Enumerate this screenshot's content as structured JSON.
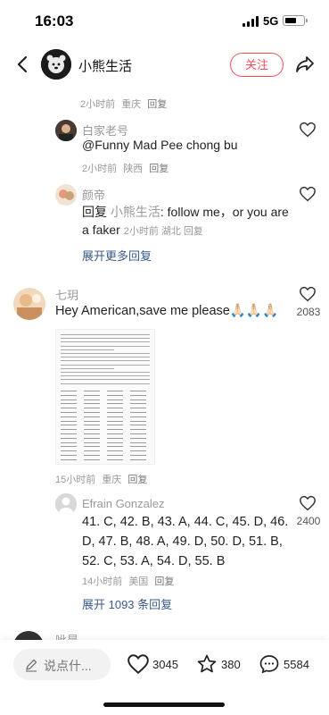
{
  "status": {
    "time": "16:03",
    "network": "5G",
    "battery_level": 0.65
  },
  "header": {
    "title": "小熊生活",
    "follow_label": "关注"
  },
  "comments": {
    "prev_meta": {
      "time": "2小时前",
      "location": "重庆",
      "reply": "回复"
    },
    "r1": {
      "name": "白家老号",
      "text": "@Funny Mad Pee chong bu",
      "meta": {
        "time": "2小时前",
        "location": "陕西",
        "reply": "回复"
      }
    },
    "r2": {
      "name": "颜帝",
      "line1_prefix": "回复 ",
      "line1_target": "小熊生活",
      "line1_rest": ": follow me，or you are",
      "line2_text": "a faker",
      "line2_meta": "2小时前 湖北 回复"
    },
    "expand_more": "展开更多回复",
    "c2": {
      "name": "七玥",
      "text": "Hey American,save me please🙏🏻🙏🏻🙏🏻",
      "likes": "2083",
      "meta": {
        "time": "15小时前",
        "location": "重庆",
        "reply": "回复"
      }
    },
    "r3": {
      "name": "Efrain Gonzalez",
      "lines": [
        "41. C, 42. B, 43. A, 44. C, 45. D, 46.",
        "D, 47. B, 48. A, 49. D, 50. D, 51. B,",
        "52. C, 53. A, 54. D, 55. B"
      ],
      "likes": "2400",
      "meta": {
        "time": "14小时前",
        "location": "美国",
        "reply": "回复"
      }
    },
    "expand_count": "展开 1093 条回复",
    "c3_name_partial": "呲是"
  },
  "bottom": {
    "input_placeholder": "说点什...",
    "likes": "3045",
    "collects": "380",
    "comments": "5584"
  },
  "colors": {
    "accent": "#e8505b",
    "link": "#3a5a8a",
    "muted": "#999999"
  }
}
